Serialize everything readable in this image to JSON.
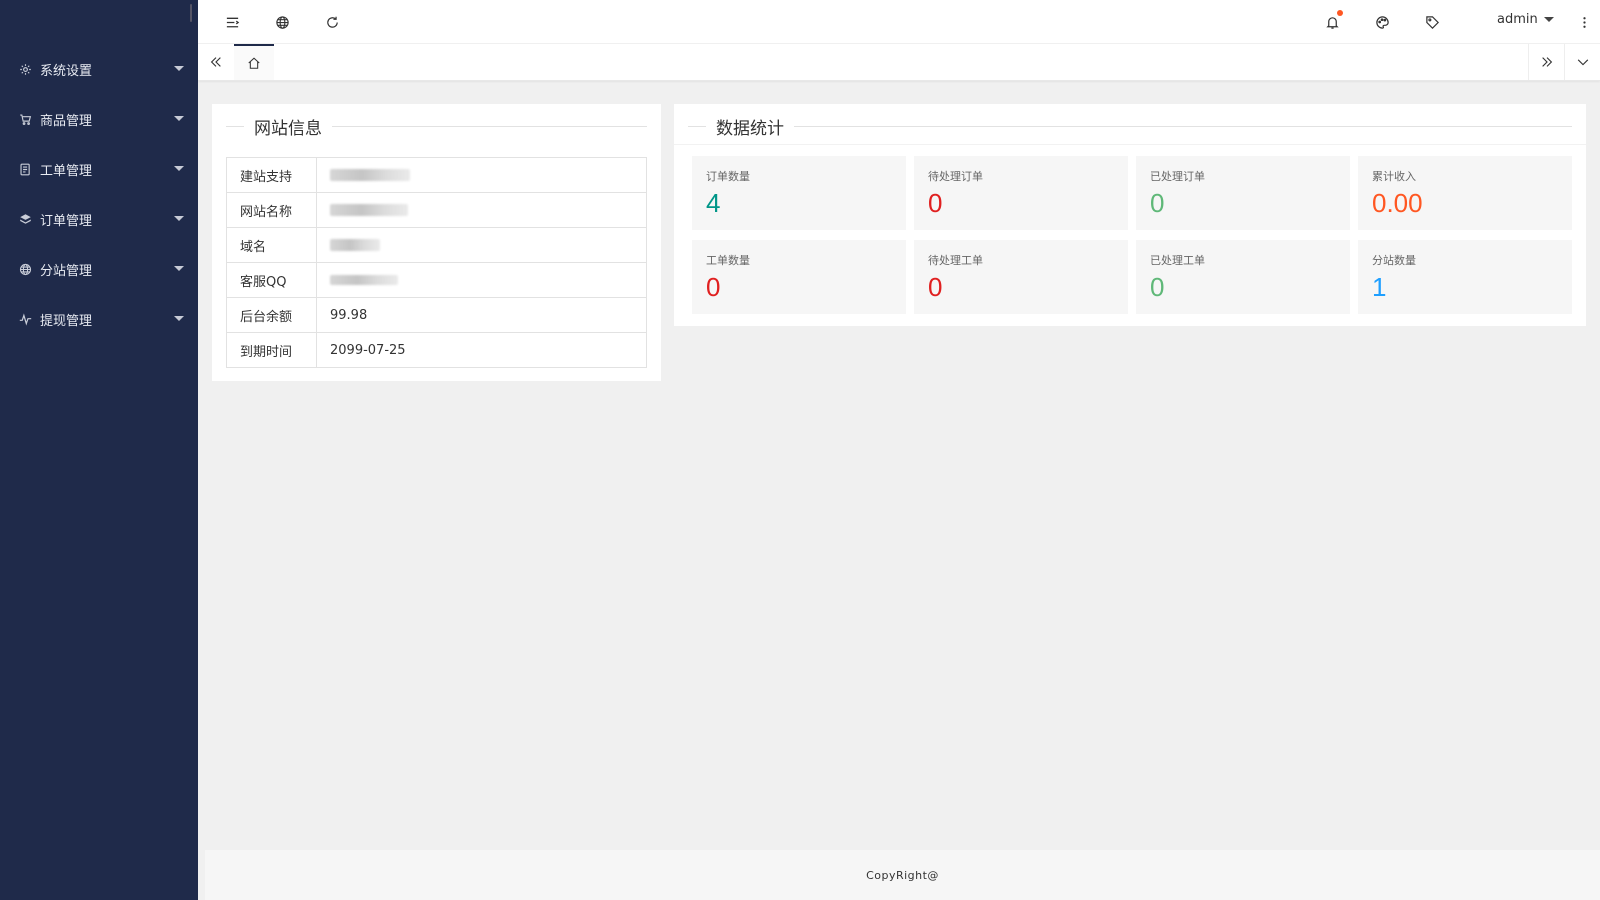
{
  "sidebar": {
    "items": [
      {
        "label": "系统设置",
        "icon": "gear-icon"
      },
      {
        "label": "商品管理",
        "icon": "cart-icon"
      },
      {
        "label": "工单管理",
        "icon": "ticket-icon"
      },
      {
        "label": "订单管理",
        "icon": "layers-icon"
      },
      {
        "label": "分站管理",
        "icon": "globe-icon"
      },
      {
        "label": "提现管理",
        "icon": "pulse-icon"
      }
    ]
  },
  "header": {
    "user": "admin"
  },
  "site_info": {
    "title": "网站信息",
    "rows": [
      {
        "key": "建站支持",
        "value": ""
      },
      {
        "key": "网站名称",
        "value": ""
      },
      {
        "key": "域名",
        "value": ""
      },
      {
        "key": "客服QQ",
        "value": ""
      },
      {
        "key": "后台余额",
        "value": "99.98"
      },
      {
        "key": "到期时间",
        "value": "2099-07-25"
      }
    ]
  },
  "stats": {
    "title": "数据统计",
    "items": [
      {
        "label": "订单数量",
        "value": "4",
        "color": "#009688"
      },
      {
        "label": "待处理订单",
        "value": "0",
        "color": "#e02020"
      },
      {
        "label": "已处理订单",
        "value": "0",
        "color": "#5fb878"
      },
      {
        "label": "累计收入",
        "value": "0.00",
        "color": "#ff5722"
      },
      {
        "label": "工单数量",
        "value": "0",
        "color": "#e02020"
      },
      {
        "label": "待处理工单",
        "value": "0",
        "color": "#e02020"
      },
      {
        "label": "已处理工单",
        "value": "0",
        "color": "#5fb878"
      },
      {
        "label": "分站数量",
        "value": "1",
        "color": "#1e9fff"
      }
    ]
  },
  "footer": {
    "text": "CopyRight@"
  }
}
